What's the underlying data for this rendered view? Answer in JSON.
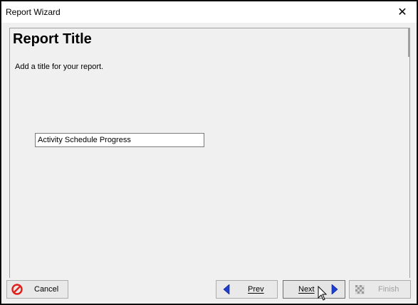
{
  "window": {
    "title": "Report Wizard",
    "close_glyph": "✕"
  },
  "page": {
    "heading": "Report Title",
    "description": "Add a title for your report.",
    "title_input_value": "Activity Schedule Progress"
  },
  "buttons": {
    "cancel": "Cancel",
    "prev": "Prev",
    "next": "Next",
    "finish": "Finish"
  },
  "icons": {
    "cancel": "cancel-circle-icon",
    "prev": "arrow-left-icon",
    "next": "arrow-right-icon",
    "finish": "checkered-flag-icon"
  },
  "colors": {
    "cancel_red": "#e0201b",
    "arrow_blue": "#1f3fd1"
  }
}
